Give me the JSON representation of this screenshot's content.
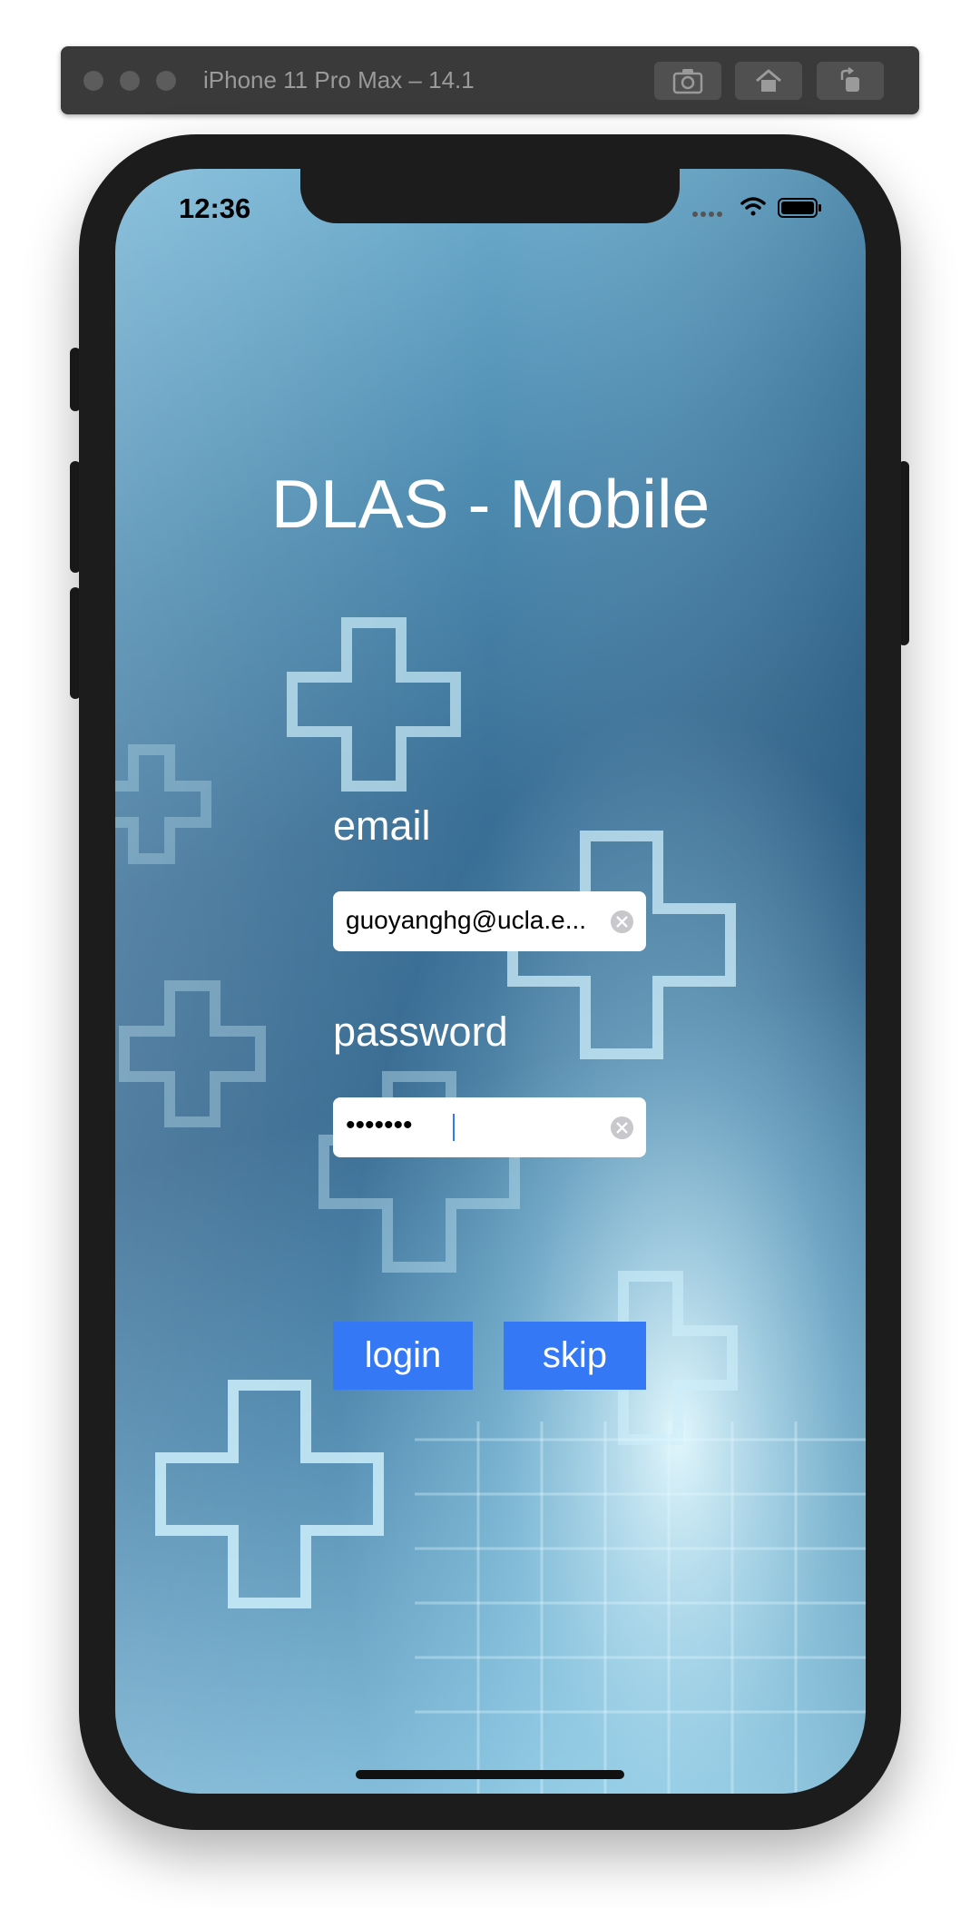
{
  "simulator": {
    "title": "iPhone 11 Pro Max – 14.1",
    "toolbar": [
      "screenshot-icon",
      "home-icon",
      "rotate-icon"
    ]
  },
  "status_bar": {
    "time": "12:36",
    "icons": [
      "signal-icon",
      "wifi-icon",
      "battery-icon"
    ]
  },
  "app": {
    "title": "DLAS - Mobile",
    "email_label": "email",
    "email_value": "guoyanghg@ucla.e...",
    "password_label": "password",
    "password_value": "•••••••",
    "login_label": "login",
    "skip_label": "skip"
  },
  "colors": {
    "accent": "#3478f6",
    "background_top": "#78b7d6",
    "background_mid": "#33678f",
    "text": "#ffffff"
  }
}
